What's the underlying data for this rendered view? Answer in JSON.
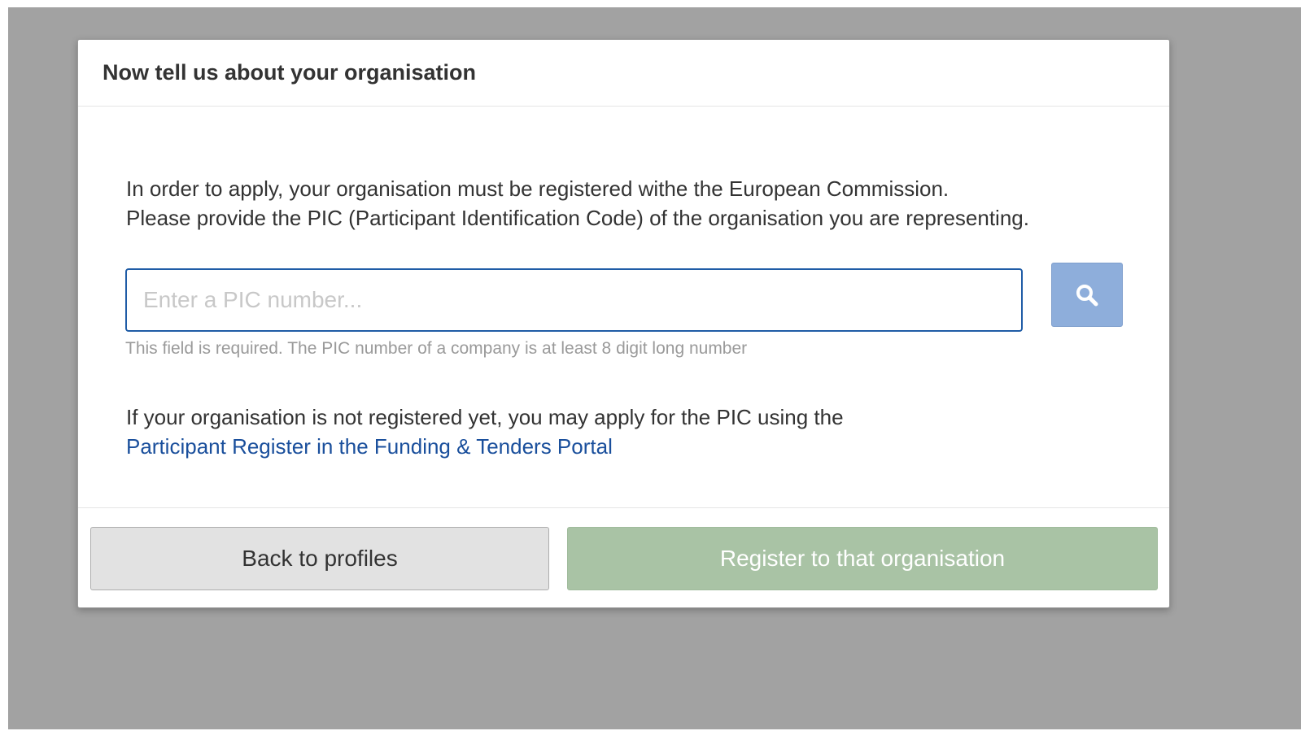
{
  "modal": {
    "title": "Now tell us about your organisation",
    "intro_line1": "In order to apply, your organisation must be registered withe the European Commission.",
    "intro_line2": "Please provide the PIC (Participant Identification Code) of the organisation you are representing.",
    "pic_input": {
      "value": "",
      "placeholder": "Enter a PIC number..."
    },
    "search_button": {
      "icon": "search-icon",
      "color": "#8eaedb"
    },
    "help_text": "This field is required. The PIC number of a company is at least 8 digit long number",
    "register_info_text": "If your organisation is not registered yet, you may apply for the PIC using the",
    "register_link_text": "Participant Register in the Funding & Tenders Portal",
    "footer": {
      "back_label": "Back to profiles",
      "register_label": "Register to that organisation"
    }
  },
  "colors": {
    "backdrop": "#a2a2a2",
    "link": "#1a4f9c",
    "input_border": "#1f5ca6",
    "register_button": "#a9c3a5",
    "back_button": "#e2e2e2"
  }
}
